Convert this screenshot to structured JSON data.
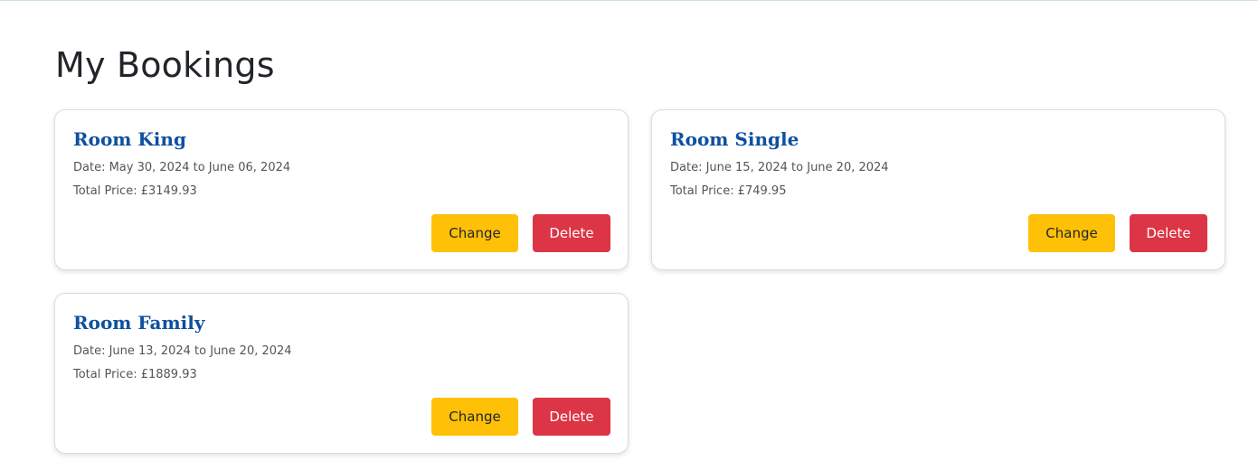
{
  "page": {
    "title": "My Bookings"
  },
  "colors": {
    "accent_title": "#0f4fa0",
    "change_button": "#ffc107",
    "delete_button": "#dc3545"
  },
  "bookings": [
    {
      "room": "Room King",
      "date": "Date: May 30, 2024 to June 06, 2024",
      "price": "Total Price: £3149.93",
      "change_label": "Change",
      "delete_label": "Delete"
    },
    {
      "room": "Room Single",
      "date": "Date: June 15, 2024 to June 20, 2024",
      "price": "Total Price: £749.95",
      "change_label": "Change",
      "delete_label": "Delete"
    },
    {
      "room": "Room Family",
      "date": "Date: June 13, 2024 to June 20, 2024",
      "price": "Total Price: £1889.93",
      "change_label": "Change",
      "delete_label": "Delete"
    }
  ]
}
